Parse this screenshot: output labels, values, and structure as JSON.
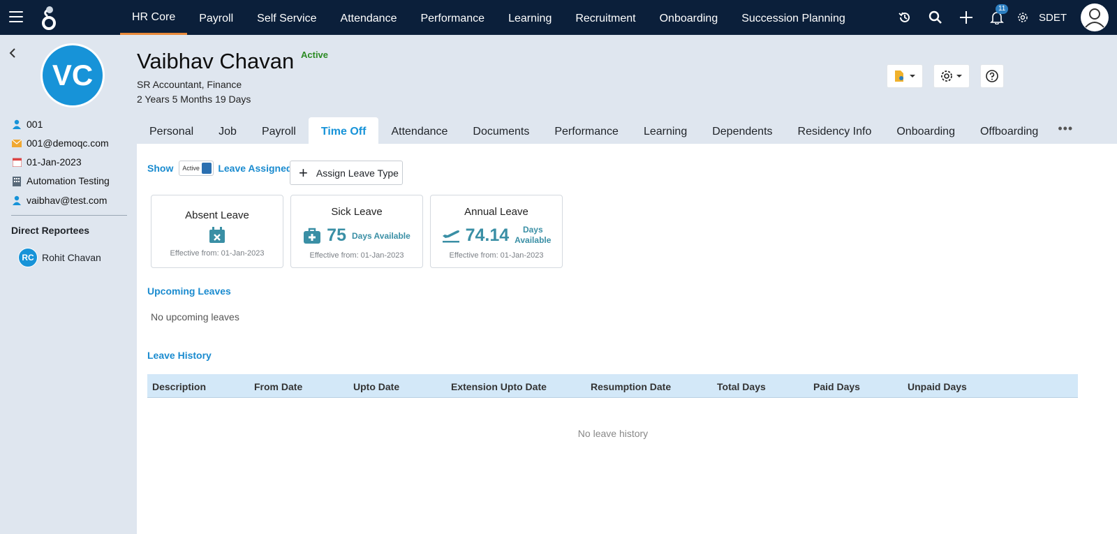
{
  "topbar": {
    "nav": [
      "HR Core",
      "Payroll",
      "Self Service",
      "Attendance",
      "Performance",
      "Learning",
      "Recruitment",
      "Onboarding",
      "Succession Planning"
    ],
    "active_nav": "HR Core",
    "notifications_count": "11",
    "user_label": "SDET",
    "icons": [
      "history-icon",
      "search-icon",
      "plus-icon",
      "bell-icon",
      "gear-icon",
      "user-avatar-icon"
    ]
  },
  "sidebar": {
    "initials": "VC",
    "emp_id": "001",
    "work_email": "001@demoqc.com",
    "join_date": "01-Jan-2023",
    "department": "Automation Testing",
    "personal_email": "vaibhav@test.com",
    "reportees_title": "Direct Reportees",
    "reportees": [
      {
        "initials": "RC",
        "name": "Rohit Chavan"
      }
    ]
  },
  "header": {
    "name": "Vaibhav Chavan",
    "status": "Active",
    "title": "SR Accountant, Finance",
    "tenure": "2 Years 5 Months 19 Days"
  },
  "tabs": [
    "Personal",
    "Job",
    "Payroll",
    "Time Off",
    "Attendance",
    "Documents",
    "Performance",
    "Learning",
    "Dependents",
    "Residency Info",
    "Onboarding",
    "Offboarding"
  ],
  "active_tab": "Time Off",
  "timeoff": {
    "show_label": "Show",
    "toggle_label": "Active",
    "leave_assigned_label": "Leave Assigned",
    "assign_button": "Assign Leave Type",
    "cards": [
      {
        "title": "Absent Leave",
        "value": "",
        "unit": "",
        "effective": "Effective from: 01-Jan-2023"
      },
      {
        "title": "Sick Leave",
        "value": "75",
        "unit": "Days Available",
        "effective": "Effective from: 01-Jan-2023"
      },
      {
        "title": "Annual Leave",
        "value": "74.14",
        "unit_line1": "Days",
        "unit_line2": "Available",
        "effective": "Effective from: 01-Jan-2023"
      }
    ],
    "upcoming_title": "Upcoming Leaves",
    "upcoming_empty": "No upcoming leaves",
    "history_title": "Leave History",
    "history_columns": [
      "Description",
      "From Date",
      "Upto Date",
      "Extension Upto Date",
      "Resumption Date",
      "Total Days",
      "Paid Days",
      "Unpaid Days"
    ],
    "history_empty": "No leave history"
  },
  "colors": {
    "topbar": "#0b1f3a",
    "accent": "#1793d8",
    "active_nav_underline": "#e8893a",
    "status_active": "#2a8a22"
  }
}
